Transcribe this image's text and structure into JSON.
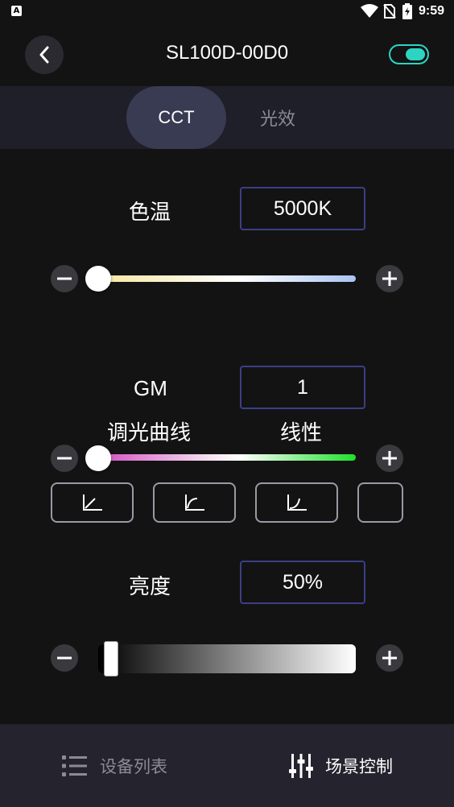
{
  "status_bar": {
    "app_badge": "A",
    "time": "9:59"
  },
  "header": {
    "title": "SL100D-00D0",
    "power_on": true
  },
  "tabs": [
    {
      "label": "CCT",
      "active": true
    },
    {
      "label": "光效",
      "active": false
    }
  ],
  "cct": {
    "label": "色温",
    "value": "5000K",
    "slider_fraction": 0.0
  },
  "gm": {
    "label": "GM",
    "value": "1",
    "slider_fraction": 0.0
  },
  "dimming_curve": {
    "label": "调光曲线",
    "value": "线性",
    "options": [
      "linear-curve",
      "log-curve",
      "exp-curve",
      "custom-curve"
    ]
  },
  "brightness": {
    "label": "亮度",
    "value": "50%",
    "slider_fraction": 0.0
  },
  "bottom_nav": {
    "device_list": "设备列表",
    "scene_control": "场景控制"
  },
  "colors": {
    "accent": "#2dd4c2",
    "value_border": "#3b3f86",
    "active_tab": "#383b52"
  }
}
